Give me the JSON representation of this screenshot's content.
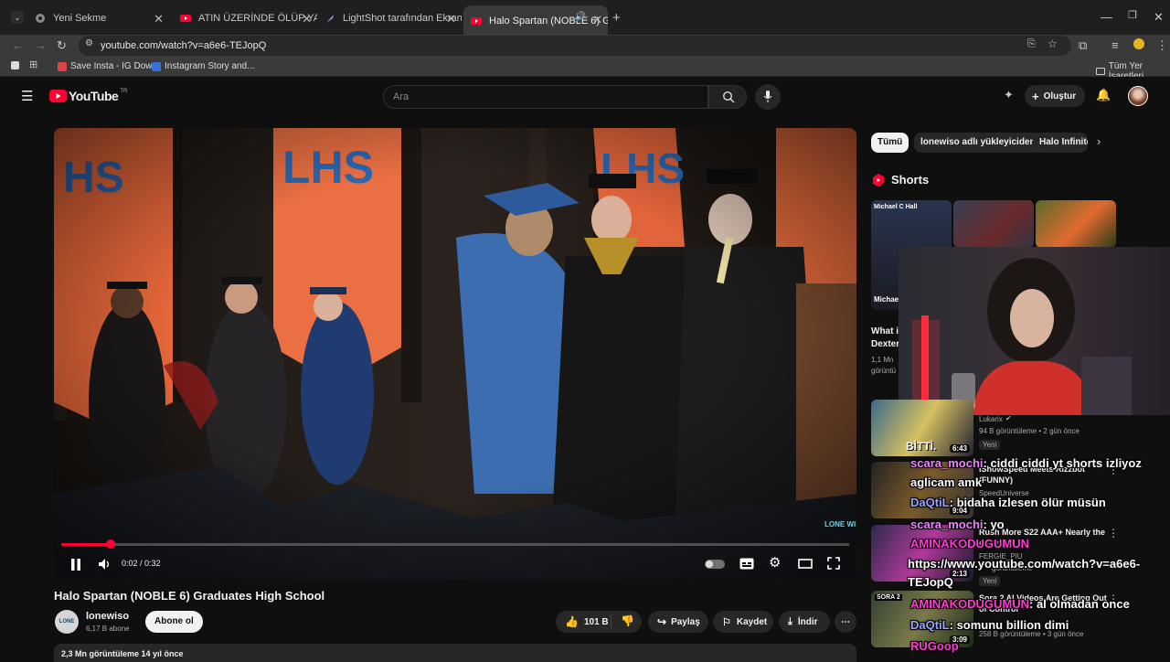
{
  "browser": {
    "tabs": [
      {
        "label": "Yeni Sekme"
      },
      {
        "label": "ATIN ÜZERİNDE ÖLÜP YARIŞI K"
      },
      {
        "label": "LightShot tarafından Ekran Gör"
      },
      {
        "label": "Halo Spartan (NOBLE 6) Gra"
      }
    ],
    "url": "youtube.com/watch?v=a6e6-TEJopQ",
    "bookmarks": [
      {
        "label": "Save Insta - IG Dow..."
      },
      {
        "label": "Instagram Story and..."
      }
    ],
    "all_bookmarks": "Tüm Yer İşaretleri"
  },
  "youtube": {
    "logo_text": "YouTube",
    "region": "TR",
    "search_placeholder": "Ara",
    "create_label": "Oluştur",
    "video": {
      "time": "0:02 / 0:32",
      "progress": 0.0625,
      "watermark": "LONE WISO",
      "title": "Halo Spartan (NOBLE 6) Graduates High School",
      "channel": "lonewiso",
      "subscribers": "6,17 B abone",
      "subscribe_label": "Abone ol",
      "likes": "101 B",
      "share_label": "Paylaş",
      "save_label": "Kaydet",
      "download_label": "İndir",
      "views": "2,3 Mn görüntüleme  14 yıl önce"
    },
    "chips": [
      "Tümü",
      "lonewiso adlı yükleyiciden",
      "Halo Infinite"
    ],
    "shorts_label": "Shorts",
    "short_partial": {
      "title_top": "Michael C Hall",
      "title": "What i Dexter",
      "meta": "1,1 Mn görüntü"
    },
    "recommendations": [
      {
        "title": "",
        "channel": "Lukarix",
        "meta": "94 B görüntüleme • 2 gün önce",
        "badge": "Yeni",
        "duration": "6:43",
        "thumb_text": "BİTTİ."
      },
      {
        "title": "IShowSpeed Meets Rizzbot (FUNNY)",
        "channel": "SpeedUniverse",
        "meta": "",
        "badge": "",
        "duration": "9:04",
        "thumb_text": ""
      },
      {
        "title": "Rush More S22 AAA+ Nearly the ending.",
        "channel": "FERGIE_PIU",
        "meta": "görüntüleme",
        "badge": "Yeni",
        "duration": "2:13",
        "thumb_text": ""
      },
      {
        "title": "Sora 2 AI Videos Are Getting Out of Control",
        "channel": "",
        "meta": "258 B görüntüleme • 3 gün önce",
        "badge": "",
        "duration": "3:09",
        "thumb_text": "SORA 2"
      }
    ]
  },
  "chat": [
    {
      "user": "scara_mochi",
      "msg": ": ciddi ciddi yt shorts izliyoz"
    },
    {
      "user": "",
      "msg": "aglicam amk"
    },
    {
      "user": "DaQtiL",
      "msg": ": bidaha izlesen ölür müsün"
    },
    {
      "user": "scara_mochi",
      "msg": ": yo"
    },
    {
      "user": "AMINAKODUGUMUN",
      "msg": ""
    },
    {
      "user": "",
      "msg": "https://www.youtube.com/watch?v=a6e6-"
    },
    {
      "user": "",
      "msg": "TEJopQ"
    },
    {
      "user": "AMINAKODUGUMUN",
      "msg": ": al olmadan once"
    },
    {
      "user": "DaQtiL",
      "msg": ": somunu billion dimi"
    },
    {
      "user": "RUGoop",
      "msg": ""
    }
  ]
}
